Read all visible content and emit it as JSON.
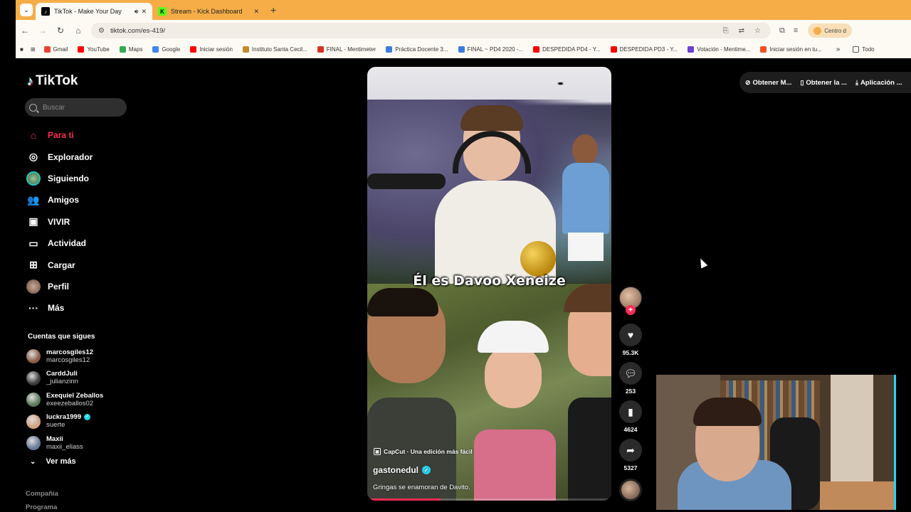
{
  "browser": {
    "tabs": [
      {
        "title": "TikTok - Make Your Day",
        "active": true,
        "favicon_color": "#000000"
      },
      {
        "title": "Stream - Kick Dashboard",
        "active": false,
        "favicon_color": "#53fc18"
      }
    ],
    "url": "tiktok.com/es-419/",
    "profile_label": "Centro d",
    "bookmarks": [
      {
        "label": "Gmail",
        "color": "#ea4335"
      },
      {
        "label": "YouTube",
        "color": "#ff0000"
      },
      {
        "label": "Maps",
        "color": "#34a853"
      },
      {
        "label": "Google",
        "color": "#4285f4"
      },
      {
        "label": "Iniciar sesión",
        "color": "#ff0000"
      },
      {
        "label": "Instituto Santa Cecil...",
        "color": "#c58b2a"
      },
      {
        "label": "FINAL - Mentimeter",
        "color": "#d93025"
      },
      {
        "label": "Práctica Docente 3...",
        "color": "#3b7ddd"
      },
      {
        "label": "FINAL ~ PD4 2020 -...",
        "color": "#3b7ddd"
      },
      {
        "label": "DESPEDIDA PD4 - Y...",
        "color": "#ff0000"
      },
      {
        "label": "DESPEDIDA PD3 - Y...",
        "color": "#ff0000"
      },
      {
        "label": "Votación - Mentime...",
        "color": "#6a3fd3"
      },
      {
        "label": "Iniciar sesión en tu...",
        "color": "#f25022"
      }
    ],
    "bookmarks_more": "»",
    "bookmarks_folder": "Todo"
  },
  "tiktok": {
    "logo": "TikTok",
    "search_placeholder": "Buscar",
    "nav": [
      {
        "label": "Para ti",
        "icon": "home-icon",
        "glyph": "⌂",
        "active": true
      },
      {
        "label": "Explorador",
        "icon": "compass-icon",
        "glyph": "◎",
        "active": false
      },
      {
        "label": "Siguiendo",
        "icon": "avatar-icon",
        "glyph": "",
        "active": false
      },
      {
        "label": "Amigos",
        "icon": "friends-icon",
        "glyph": "👥",
        "active": false
      },
      {
        "label": "VIVIR",
        "icon": "live-icon",
        "glyph": "▣",
        "active": false
      },
      {
        "label": "Actividad",
        "icon": "message-icon",
        "glyph": "▭",
        "active": false
      },
      {
        "label": "Cargar",
        "icon": "upload-icon",
        "glyph": "⊞",
        "active": false
      },
      {
        "label": "Perfil",
        "icon": "profile-icon",
        "glyph": "",
        "active": false
      },
      {
        "label": "Más",
        "icon": "more-icon",
        "glyph": "···",
        "active": false
      }
    ],
    "following_title": "Cuentas que sigues",
    "following": [
      {
        "name": "marcosgiles12",
        "user": "marcosgiles12",
        "verified": false,
        "color": "#8a5a44"
      },
      {
        "name": "CarddJuli",
        "user": "_julianzinn",
        "verified": false,
        "color": "#3a3a3a"
      },
      {
        "name": "Exequiel Zeballos",
        "user": "exeezeballos02",
        "verified": false,
        "color": "#5b7a5a"
      },
      {
        "name": "luckra1999",
        "user": "suerte",
        "verified": true,
        "color": "#d4a080"
      },
      {
        "name": "Maxii",
        "user": "maxii_eliass",
        "verified": false,
        "color": "#6a7a9a"
      }
    ],
    "see_more": "Ver más",
    "footer": [
      "Compañía",
      "Programa"
    ],
    "top_actions": [
      {
        "label": "Obtener M...",
        "icon": "coin-icon",
        "glyph": "⊘"
      },
      {
        "label": "Obtener la ...",
        "icon": "phone-icon",
        "glyph": "▯"
      },
      {
        "label": "Aplicación ...",
        "icon": "download-icon",
        "glyph": "⤓"
      }
    ]
  },
  "video": {
    "overlay_text": "Él es Davoo Xeneize",
    "capcut_label": "CapCut · Una edición más fácil",
    "author": "gastonedul",
    "author_verified": true,
    "description": "Gringas se enamoran de Davito.",
    "progress": 0.3,
    "likes": "95.3K",
    "comments": "253",
    "saves": "4624",
    "shares": "5327"
  }
}
